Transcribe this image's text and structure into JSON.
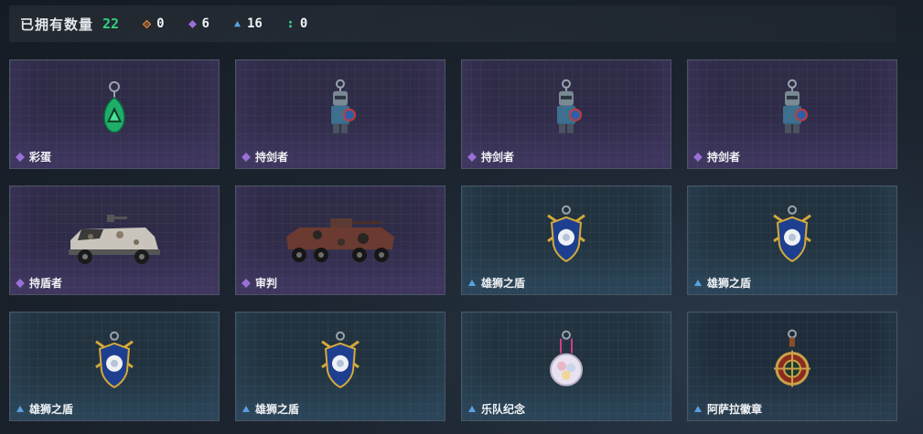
{
  "summary": {
    "owned_label": "已拥有数量",
    "owned_count": "22",
    "rarity_counts": [
      {
        "icon": "orange-diamond-icon",
        "color": "#d9813a",
        "count": "0"
      },
      {
        "icon": "purple-diamond-icon",
        "color": "#9a6fd6",
        "count": "6"
      },
      {
        "icon": "blue-triangle-icon",
        "color": "#5aa0e0",
        "count": "16"
      },
      {
        "icon": "green-dots-icon",
        "color": "#3fc98a",
        "count": "0"
      }
    ]
  },
  "items": [
    {
      "name": "彩蛋",
      "rarity": "purple",
      "art": "egg-charm"
    },
    {
      "name": "持剑者",
      "rarity": "purple",
      "art": "knight-charm"
    },
    {
      "name": "持剑者",
      "rarity": "purple",
      "art": "knight-charm"
    },
    {
      "name": "持剑者",
      "rarity": "purple",
      "art": "knight-charm"
    },
    {
      "name": "持盾者",
      "rarity": "purple",
      "art": "armored-truck"
    },
    {
      "name": "审判",
      "rarity": "purple",
      "art": "apc-vehicle"
    },
    {
      "name": "雄狮之盾",
      "rarity": "blue",
      "art": "lion-shield-charm"
    },
    {
      "name": "雄狮之盾",
      "rarity": "blue",
      "art": "lion-shield-charm"
    },
    {
      "name": "雄狮之盾",
      "rarity": "blue",
      "art": "lion-shield-charm"
    },
    {
      "name": "雄狮之盾",
      "rarity": "blue",
      "art": "lion-shield-charm"
    },
    {
      "name": "乐队纪念",
      "rarity": "blue",
      "art": "band-badge-charm"
    },
    {
      "name": "阿萨拉徽章",
      "rarity": "blue",
      "art": "asara-emblem-charm"
    }
  ]
}
